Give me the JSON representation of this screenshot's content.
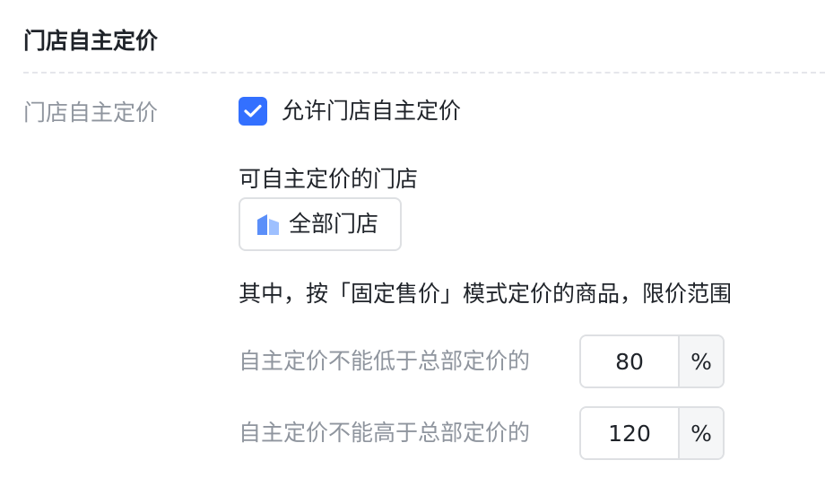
{
  "section": {
    "title": "门店自主定价"
  },
  "field": {
    "label": "门店自主定价",
    "checkbox_label": "允许门店自主定价",
    "checkbox_checked": true,
    "stores_label": "可自主定价的门店",
    "stores_button_label": "全部门店",
    "range_description": "其中，按「固定售价」模式定价的商品，限价范围",
    "min_label": "自主定价不能低于总部定价的",
    "min_value": "80",
    "max_label": "自主定价不能高于总部定价的",
    "max_value": "120",
    "unit": "%"
  },
  "colors": {
    "accent": "#3370ff",
    "label_gray": "#8f959e",
    "border": "#dee0e3",
    "store_icon": "#5b8ff9"
  },
  "icons": {
    "checkbox": "check-icon",
    "store": "store-icon"
  }
}
